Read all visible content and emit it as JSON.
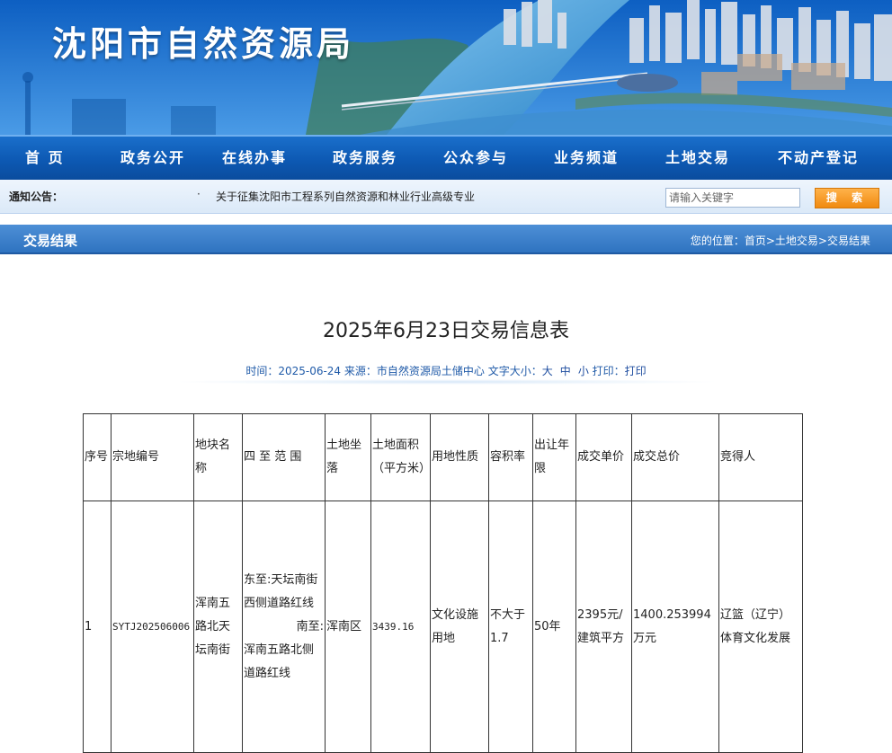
{
  "banner": {
    "site_title": "沈阳市自然资源局"
  },
  "nav": {
    "items": [
      "首 页",
      "政务公开",
      "在线办事",
      "政务服务",
      "公众参与",
      "业务频道",
      "土地交易",
      "不动产登记"
    ]
  },
  "notice": {
    "label": "通知公告：",
    "bullet": "·",
    "text": "关于征集沈阳市工程系列自然资源和林业行业高级专业",
    "search_placeholder": "请输入关键字",
    "search_button": "搜 索"
  },
  "section": {
    "title": "交易结果",
    "breadcrumb_prefix": "您的位置：",
    "crumbs": [
      "首页",
      "土地交易",
      "交易结果"
    ],
    "crumb_sep": ">"
  },
  "article": {
    "title": "2025年6月23日交易信息表",
    "meta_time_label": "时间：",
    "meta_time": "2025-06-24",
    "meta_source_label": "来源：",
    "meta_source": "市自然资源局土储中心",
    "font_size_label": "文字大小：",
    "font_large": "大",
    "font_medium": "中",
    "font_small": "小",
    "print_label": "打印：",
    "print_link": "打印"
  },
  "table": {
    "headers": [
      "序号",
      "宗地编号",
      "地块名称",
      "四 至 范 围",
      "土地坐落",
      "土地面积（平方米）",
      "用地性质",
      "容积率",
      "出让年限",
      "成交单价",
      "成交总价",
      "竞得人"
    ],
    "rows": [
      {
        "seq": "1",
        "code": "SYTJ2025060​06",
        "name": "浑南五路北天坛南街",
        "bounds_east": "东至:天坛南街西侧道路红线",
        "bounds_south": "南至:",
        "bounds_south_2": "浑南五路北侧道路红线",
        "location": "浑南区",
        "area": "3439.16",
        "use": "文化设施用地",
        "far": "不大于1.7",
        "term": "50年",
        "unit_price": "2395元/建筑平方",
        "total_price": "1400.253994万元",
        "winner": "辽篮（辽宁）体育文化发展"
      }
    ]
  }
}
